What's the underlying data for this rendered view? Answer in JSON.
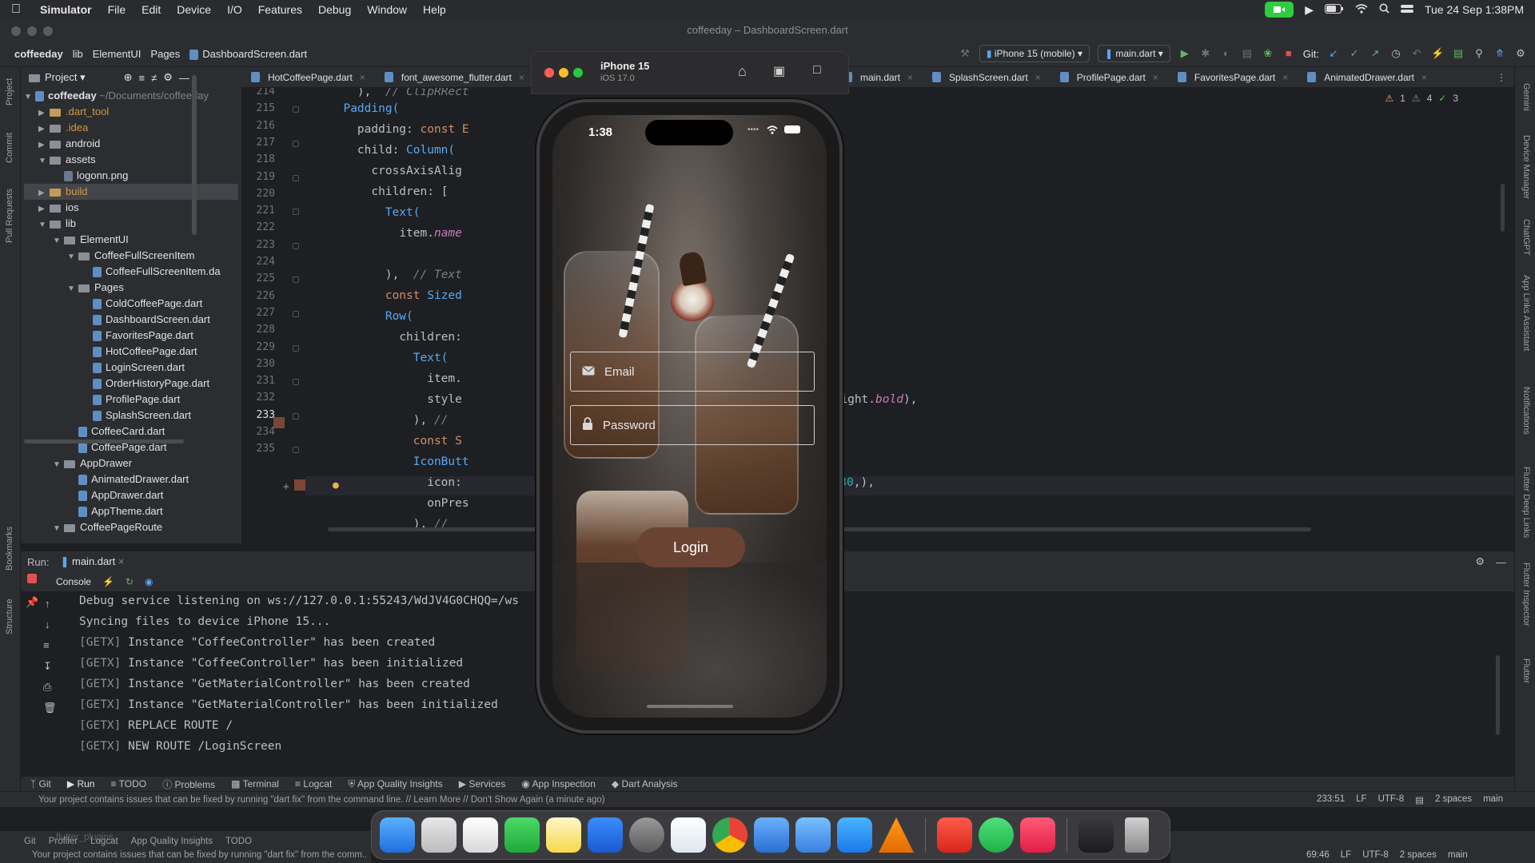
{
  "menubar": {
    "app": "Simulator",
    "items": [
      "File",
      "Edit",
      "Device",
      "I/O",
      "Features",
      "Debug",
      "Window",
      "Help"
    ],
    "datetime": "Tue 24 Sep  1:38PM"
  },
  "window": {
    "title": "coffeeday – DashboardScreen.dart"
  },
  "breadcrumb": [
    "coffeeday",
    "lib",
    "ElementUI",
    "Pages",
    "DashboardScreen.dart"
  ],
  "toolbar": {
    "device": "iPhone 15 (mobile)",
    "run_config": "main.dart",
    "git_label": "Git:"
  },
  "project": {
    "header": "Project",
    "root_name": "coffeeday",
    "root_path": "~/Documents/coffeeday",
    "rows": [
      {
        "label": ".dart_tool",
        "kind": "folder-orange",
        "depth": 1,
        "arrow": "right",
        "orange": true
      },
      {
        "label": ".idea",
        "kind": "folder",
        "depth": 1,
        "arrow": "right",
        "orange": true
      },
      {
        "label": "android",
        "kind": "folder",
        "depth": 1,
        "arrow": "right"
      },
      {
        "label": "assets",
        "kind": "folder",
        "depth": 1,
        "arrow": "down"
      },
      {
        "label": "logonn.png",
        "kind": "png",
        "depth": 2
      },
      {
        "label": "build",
        "kind": "folder-orange",
        "depth": 1,
        "arrow": "right",
        "orange": true,
        "hl": true
      },
      {
        "label": "ios",
        "kind": "folder",
        "depth": 1,
        "arrow": "right"
      },
      {
        "label": "lib",
        "kind": "folder",
        "depth": 1,
        "arrow": "down"
      },
      {
        "label": "ElementUI",
        "kind": "folder",
        "depth": 2,
        "arrow": "down"
      },
      {
        "label": "CoffeeFullScreenItem",
        "kind": "folder",
        "depth": 3,
        "arrow": "down"
      },
      {
        "label": "CoffeeFullScreenItem.da",
        "kind": "dart",
        "depth": 4
      },
      {
        "label": "Pages",
        "kind": "folder",
        "depth": 3,
        "arrow": "down"
      },
      {
        "label": "ColdCoffeePage.dart",
        "kind": "dart",
        "depth": 4
      },
      {
        "label": "DashboardScreen.dart",
        "kind": "dart",
        "depth": 4
      },
      {
        "label": "FavoritesPage.dart",
        "kind": "dart",
        "depth": 4
      },
      {
        "label": "HotCoffeePage.dart",
        "kind": "dart",
        "depth": 4
      },
      {
        "label": "LoginScreen.dart",
        "kind": "dart",
        "depth": 4
      },
      {
        "label": "OrderHistoryPage.dart",
        "kind": "dart",
        "depth": 4
      },
      {
        "label": "ProfilePage.dart",
        "kind": "dart",
        "depth": 4
      },
      {
        "label": "SplashScreen.dart",
        "kind": "dart",
        "depth": 4
      },
      {
        "label": "CoffeeCard.dart",
        "kind": "dart",
        "depth": 3
      },
      {
        "label": "CoffeePage.dart",
        "kind": "dart",
        "depth": 3
      },
      {
        "label": "AppDrawer",
        "kind": "folder",
        "depth": 2,
        "arrow": "down"
      },
      {
        "label": "AnimatedDrawer.dart",
        "kind": "dart",
        "depth": 3
      },
      {
        "label": "AppDrawer.dart",
        "kind": "dart",
        "depth": 3
      },
      {
        "label": "AppTheme.dart",
        "kind": "dart",
        "depth": 3
      },
      {
        "label": "CoffeePageRoute",
        "kind": "folder",
        "depth": 2,
        "arrow": "down"
      }
    ]
  },
  "tabs": [
    "HotCoffeePage.dart",
    "font_awesome_flutter.dart",
    "main.dart",
    "SplashScreen.dart",
    "ProfilePage.dart",
    "FavoritesPage.dart",
    "AnimatedDrawer.dart"
  ],
  "inspections": {
    "warnings": "1",
    "weak": "4",
    "ok": "3"
  },
  "editor": {
    "line_numbers": [
      "214",
      "215",
      "216",
      "217",
      "218",
      "219",
      "220",
      "221",
      "222",
      "223",
      "224",
      "225",
      "226",
      "227",
      "228",
      "229",
      "230",
      "231",
      "232",
      "233",
      "234",
      "235"
    ],
    "current_line": "233"
  },
  "run": {
    "label": "Run:",
    "config": "main.dart",
    "console_tab": "Console",
    "lines": [
      {
        "tag": "",
        "text": "Debug service listening on ws://127.0.0.1:55243/WdJV4G0CHQQ=/ws"
      },
      {
        "tag": "",
        "text": "Syncing files to device iPhone 15..."
      },
      {
        "tag": "[GETX]",
        "text": " Instance \"CoffeeController\" has been created"
      },
      {
        "tag": "[GETX]",
        "text": " Instance \"CoffeeController\" has been initialized"
      },
      {
        "tag": "[GETX]",
        "text": " Instance \"GetMaterialController\" has been created"
      },
      {
        "tag": "[GETX]",
        "text": " Instance \"GetMaterialController\" has been initialized"
      },
      {
        "tag": "[GETX]",
        "text": " REPLACE ROUTE /"
      },
      {
        "tag": "[GETX]",
        "text": " NEW ROUTE /LoginScreen"
      }
    ]
  },
  "bottom_tools": [
    "Git",
    "Run",
    "TODO",
    "Problems",
    "Terminal",
    "Logcat",
    "App Quality Insights",
    "Services",
    "App Inspection",
    "Dart Analysis"
  ],
  "status": {
    "message": "Your project contains issues that can be fixed by running \"dart fix\" from the command line. // Learn More // Don't Show Again (a minute ago)",
    "position": "233:51",
    "line_sep": "LF",
    "encoding": "UTF-8",
    "indent": "2 spaces",
    "branch": "main"
  },
  "bottom_strip": {
    "tools": [
      "Git",
      "Profiler",
      "Logcat",
      "App Quality Insights",
      "TODO"
    ],
    "message": "Your project contains issues that can be fixed by running \"dart fix\" from the comm...",
    "position": "69:46",
    "line_sep": "LF",
    "encoding": "UTF-8",
    "indent": "2 spaces",
    "branch": "main",
    "folder": "flutter_plugins"
  },
  "simulator": {
    "device": "iPhone 15",
    "os": "iOS 17.0",
    "time": "1:38",
    "email_placeholder": "Email",
    "password_placeholder": "Password",
    "login_label": "Login"
  },
  "side_labels_left": [
    "Project",
    "Commit",
    "Pull Requests",
    "Bookmarks",
    "Structure"
  ],
  "side_labels_right": [
    "Gemini",
    "Device Manager",
    "ChatGPT",
    "App Links Assistant",
    "Notifications",
    "Flutter Deep Links",
    "Flutter Inspector",
    "Flutter"
  ]
}
